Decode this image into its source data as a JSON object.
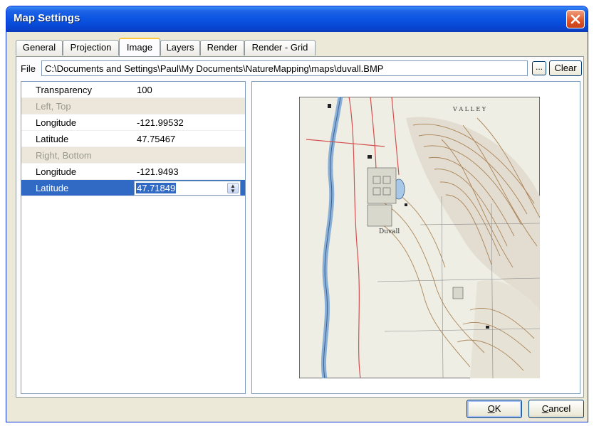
{
  "window": {
    "title": "Map Settings"
  },
  "tabs": [
    {
      "label": "General",
      "active": false
    },
    {
      "label": "Projection",
      "active": false
    },
    {
      "label": "Image",
      "active": true
    },
    {
      "label": "Layers",
      "active": false
    },
    {
      "label": "Render",
      "active": false
    },
    {
      "label": "Render - Grid",
      "active": false
    }
  ],
  "file": {
    "label": "File",
    "path": "C:\\Documents and Settings\\Paul\\My Documents\\NatureMapping\\maps\\duvall.BMP",
    "browse_label": "...",
    "clear_label": "Clear"
  },
  "properties": {
    "transparency": {
      "name": "Transparency",
      "value": "100"
    },
    "left_top": {
      "category": "Left, Top",
      "longitude": {
        "name": "Longitude",
        "value": "-121.99532"
      },
      "latitude": {
        "name": "Latitude",
        "value": "47.75467"
      }
    },
    "right_bottom": {
      "category": "Right, Bottom",
      "longitude": {
        "name": "Longitude",
        "value": "-121.9493"
      },
      "latitude": {
        "name": "Latitude",
        "value": "47.71849"
      }
    }
  },
  "preview": {
    "map_labels": {
      "valley": "V A L L E Y",
      "town": "Duvall"
    }
  },
  "buttons": {
    "ok_access": "O",
    "ok_rest": "K",
    "cancel_access": "C",
    "cancel_rest": "ancel"
  },
  "colors": {
    "title_bar": "#0a54e2",
    "selection": "#316ac5",
    "map_background": "#eeeee4",
    "map_water": "#a8c8e8",
    "map_contour": "#a67a4a",
    "map_road": "#d45050"
  },
  "icons": {
    "close": "close-x-icon",
    "spin": "spin-updown-icon"
  }
}
